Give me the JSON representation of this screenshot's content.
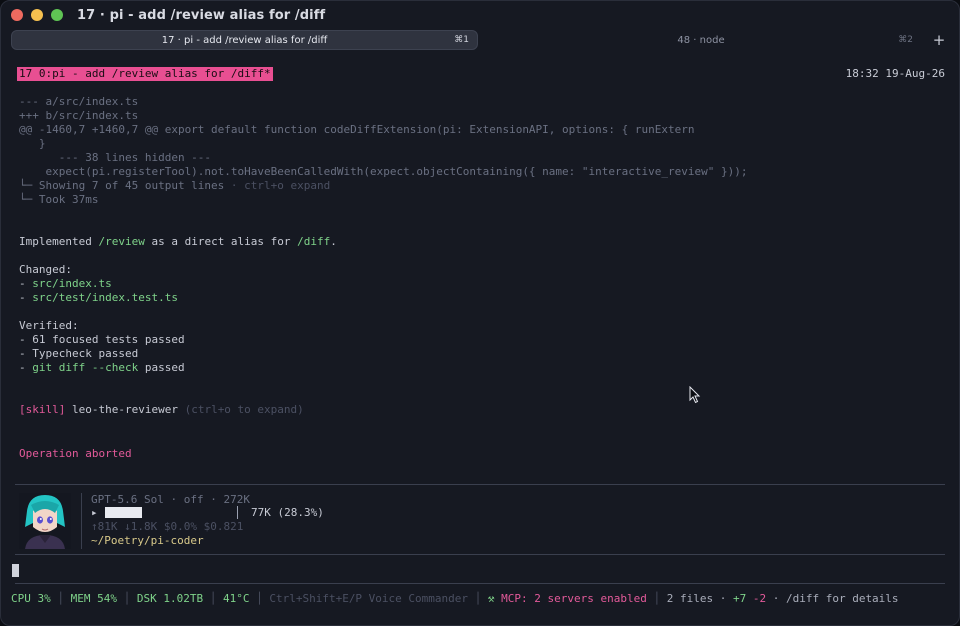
{
  "window": {
    "title": "17 · pi - add /review alias for /diff",
    "traffic_colors": [
      "#ee6a5f",
      "#f5c04f",
      "#5fc454"
    ]
  },
  "tabs": [
    {
      "label": "17 · pi - add /review alias for /diff",
      "shortcut": "⌘1",
      "active": true
    },
    {
      "label": "48 · node",
      "shortcut": "⌘2",
      "active": false
    }
  ],
  "tab_add_label": "+",
  "session": {
    "badge": "17 0:pi - add /review alias for /diff*",
    "clock": "18:32 19-Aug-26"
  },
  "diff": {
    "file_a": "--- a/src/index.ts",
    "file_b": "+++ b/src/index.ts",
    "hunk": "@@ -1460,7 +1460,7 @@ export default function codeDiffExtension(pi: ExtensionAPI, options: { runExtern",
    "brace": "   }",
    "hidden": "      --- 38 lines hidden ---",
    "code": "    expect(pi.registerTool).not.toHaveBeenCalledWith(expect.objectContaining({ name: \"interactive_review\" }));",
    "showing_prefix": "└─ Showing 7 of 45 output lines ",
    "showing_hint": "· ctrl+o expand",
    "took": "└─ Took 37ms"
  },
  "message": {
    "pre": "Implemented ",
    "cmd1": "/review",
    "mid": " as a direct alias for ",
    "cmd2": "/diff",
    "post": ".",
    "changed_heading": "Changed:",
    "changed_files": [
      "src/index.ts",
      "src/test/index.test.ts"
    ],
    "verified_heading": "Verified:",
    "verified_items": [
      {
        "pre": "61 focused tests passed",
        "code": "",
        "post": ""
      },
      {
        "pre": "Typecheck passed",
        "code": "",
        "post": ""
      },
      {
        "pre": "",
        "code": "git diff --check",
        "post": " passed"
      }
    ],
    "bullet": "- "
  },
  "skill": {
    "tag": "[skill]",
    "name": " leo-the-reviewer",
    "hint": " (ctrl+o to expand)"
  },
  "aborted": "Operation aborted",
  "footer": {
    "model_line": "GPT-5.6 Sol · off · 272K",
    "progress_marker": "▸",
    "context_usage": "77K (28.3%)",
    "context_fraction": 0.283,
    "stats_line": "↑81K ↓1.8K $0.0% $0.821",
    "cwd": "~/Poetry/pi-coder"
  },
  "statusbar": {
    "cpu": "CPU 3%",
    "mem": "MEM 54%",
    "dsk": "DSK 1.02TB",
    "temp": "41°C",
    "voice": "Ctrl+Shift+E/P Voice Commander",
    "mcp_icon": "⚒",
    "mcp": "MCP: 2 servers enabled",
    "files": "2 files",
    "added": "+7",
    "removed": "-2",
    "diff_hint": "/diff for details",
    "sep": " │ ",
    "dot": " · "
  }
}
